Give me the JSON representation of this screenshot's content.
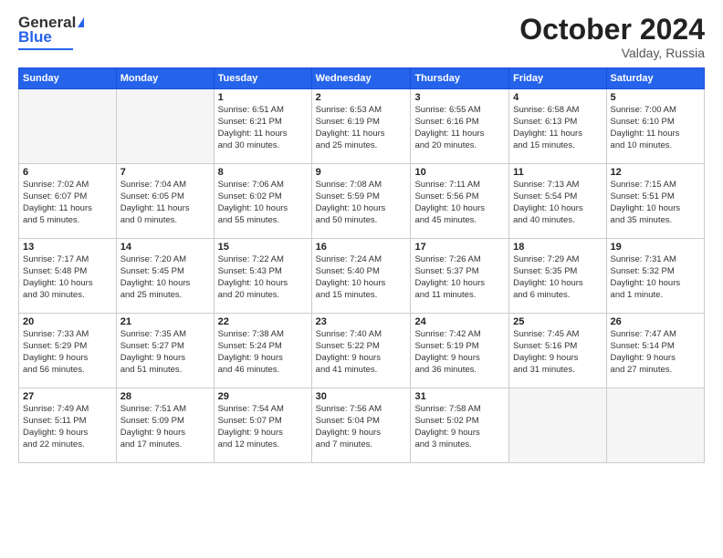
{
  "header": {
    "logo_general": "General",
    "logo_blue": "Blue",
    "month_title": "October 2024",
    "location": "Valday, Russia"
  },
  "weekdays": [
    "Sunday",
    "Monday",
    "Tuesday",
    "Wednesday",
    "Thursday",
    "Friday",
    "Saturday"
  ],
  "weeks": [
    [
      {
        "day": "",
        "info": ""
      },
      {
        "day": "",
        "info": ""
      },
      {
        "day": "1",
        "info": "Sunrise: 6:51 AM\nSunset: 6:21 PM\nDaylight: 11 hours\nand 30 minutes."
      },
      {
        "day": "2",
        "info": "Sunrise: 6:53 AM\nSunset: 6:19 PM\nDaylight: 11 hours\nand 25 minutes."
      },
      {
        "day": "3",
        "info": "Sunrise: 6:55 AM\nSunset: 6:16 PM\nDaylight: 11 hours\nand 20 minutes."
      },
      {
        "day": "4",
        "info": "Sunrise: 6:58 AM\nSunset: 6:13 PM\nDaylight: 11 hours\nand 15 minutes."
      },
      {
        "day": "5",
        "info": "Sunrise: 7:00 AM\nSunset: 6:10 PM\nDaylight: 11 hours\nand 10 minutes."
      }
    ],
    [
      {
        "day": "6",
        "info": "Sunrise: 7:02 AM\nSunset: 6:07 PM\nDaylight: 11 hours\nand 5 minutes."
      },
      {
        "day": "7",
        "info": "Sunrise: 7:04 AM\nSunset: 6:05 PM\nDaylight: 11 hours\nand 0 minutes."
      },
      {
        "day": "8",
        "info": "Sunrise: 7:06 AM\nSunset: 6:02 PM\nDaylight: 10 hours\nand 55 minutes."
      },
      {
        "day": "9",
        "info": "Sunrise: 7:08 AM\nSunset: 5:59 PM\nDaylight: 10 hours\nand 50 minutes."
      },
      {
        "day": "10",
        "info": "Sunrise: 7:11 AM\nSunset: 5:56 PM\nDaylight: 10 hours\nand 45 minutes."
      },
      {
        "day": "11",
        "info": "Sunrise: 7:13 AM\nSunset: 5:54 PM\nDaylight: 10 hours\nand 40 minutes."
      },
      {
        "day": "12",
        "info": "Sunrise: 7:15 AM\nSunset: 5:51 PM\nDaylight: 10 hours\nand 35 minutes."
      }
    ],
    [
      {
        "day": "13",
        "info": "Sunrise: 7:17 AM\nSunset: 5:48 PM\nDaylight: 10 hours\nand 30 minutes."
      },
      {
        "day": "14",
        "info": "Sunrise: 7:20 AM\nSunset: 5:45 PM\nDaylight: 10 hours\nand 25 minutes."
      },
      {
        "day": "15",
        "info": "Sunrise: 7:22 AM\nSunset: 5:43 PM\nDaylight: 10 hours\nand 20 minutes."
      },
      {
        "day": "16",
        "info": "Sunrise: 7:24 AM\nSunset: 5:40 PM\nDaylight: 10 hours\nand 15 minutes."
      },
      {
        "day": "17",
        "info": "Sunrise: 7:26 AM\nSunset: 5:37 PM\nDaylight: 10 hours\nand 11 minutes."
      },
      {
        "day": "18",
        "info": "Sunrise: 7:29 AM\nSunset: 5:35 PM\nDaylight: 10 hours\nand 6 minutes."
      },
      {
        "day": "19",
        "info": "Sunrise: 7:31 AM\nSunset: 5:32 PM\nDaylight: 10 hours\nand 1 minute."
      }
    ],
    [
      {
        "day": "20",
        "info": "Sunrise: 7:33 AM\nSunset: 5:29 PM\nDaylight: 9 hours\nand 56 minutes."
      },
      {
        "day": "21",
        "info": "Sunrise: 7:35 AM\nSunset: 5:27 PM\nDaylight: 9 hours\nand 51 minutes."
      },
      {
        "day": "22",
        "info": "Sunrise: 7:38 AM\nSunset: 5:24 PM\nDaylight: 9 hours\nand 46 minutes."
      },
      {
        "day": "23",
        "info": "Sunrise: 7:40 AM\nSunset: 5:22 PM\nDaylight: 9 hours\nand 41 minutes."
      },
      {
        "day": "24",
        "info": "Sunrise: 7:42 AM\nSunset: 5:19 PM\nDaylight: 9 hours\nand 36 minutes."
      },
      {
        "day": "25",
        "info": "Sunrise: 7:45 AM\nSunset: 5:16 PM\nDaylight: 9 hours\nand 31 minutes."
      },
      {
        "day": "26",
        "info": "Sunrise: 7:47 AM\nSunset: 5:14 PM\nDaylight: 9 hours\nand 27 minutes."
      }
    ],
    [
      {
        "day": "27",
        "info": "Sunrise: 7:49 AM\nSunset: 5:11 PM\nDaylight: 9 hours\nand 22 minutes."
      },
      {
        "day": "28",
        "info": "Sunrise: 7:51 AM\nSunset: 5:09 PM\nDaylight: 9 hours\nand 17 minutes."
      },
      {
        "day": "29",
        "info": "Sunrise: 7:54 AM\nSunset: 5:07 PM\nDaylight: 9 hours\nand 12 minutes."
      },
      {
        "day": "30",
        "info": "Sunrise: 7:56 AM\nSunset: 5:04 PM\nDaylight: 9 hours\nand 7 minutes."
      },
      {
        "day": "31",
        "info": "Sunrise: 7:58 AM\nSunset: 5:02 PM\nDaylight: 9 hours\nand 3 minutes."
      },
      {
        "day": "",
        "info": ""
      },
      {
        "day": "",
        "info": ""
      }
    ]
  ]
}
